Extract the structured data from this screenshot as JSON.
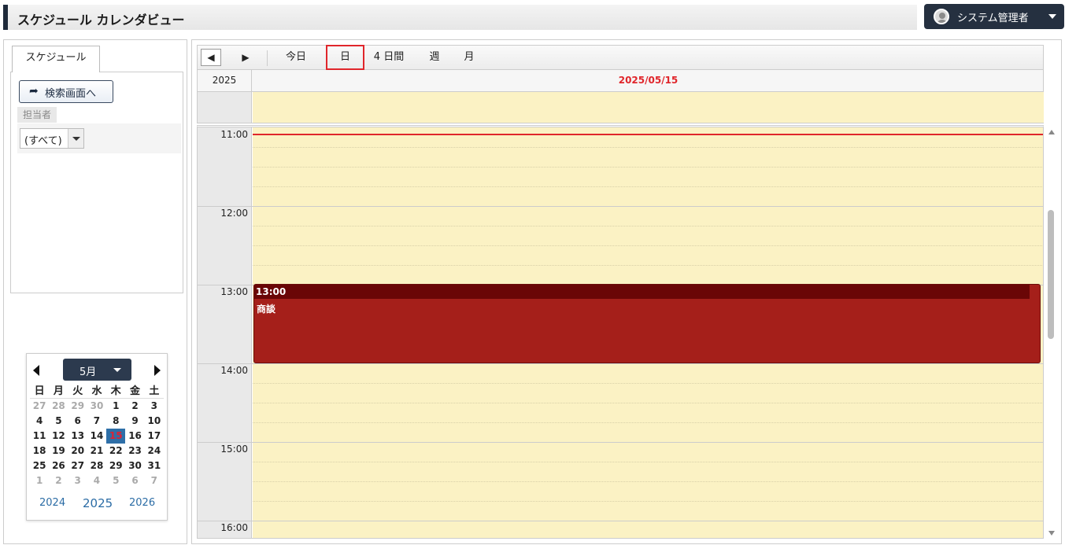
{
  "header": {
    "title": "スケジュール カレンダビュー",
    "user_name": "システム管理者"
  },
  "sidebar": {
    "tab_label": "スケジュール",
    "search_button": "検索画面へ",
    "assignee_label": "担当者",
    "assignee_value": "(すべて)"
  },
  "mini_calendar": {
    "month": "5月",
    "weekdays": [
      "日",
      "月",
      "火",
      "水",
      "木",
      "金",
      "土"
    ],
    "weeks": [
      [
        "27",
        "28",
        "29",
        "30",
        "1",
        "2",
        "3"
      ],
      [
        "4",
        "5",
        "6",
        "7",
        "8",
        "9",
        "10"
      ],
      [
        "11",
        "12",
        "13",
        "14",
        "15",
        "16",
        "17"
      ],
      [
        "18",
        "19",
        "20",
        "21",
        "22",
        "23",
        "24"
      ],
      [
        "25",
        "26",
        "27",
        "28",
        "29",
        "30",
        "31"
      ],
      [
        "1",
        "2",
        "3",
        "4",
        "5",
        "6",
        "7"
      ]
    ],
    "selected_day": "15",
    "years": [
      "2024",
      "2025",
      "2026"
    ]
  },
  "toolbar": {
    "prev": "◀",
    "next": "▶",
    "today": "今日",
    "day": "日",
    "four_days": "4 日間",
    "week": "週",
    "month": "月"
  },
  "calendar": {
    "year": "2025",
    "date": "2025/05/15",
    "hours": [
      "11:00",
      "12:00",
      "13:00",
      "14:00",
      "15:00",
      "16:00"
    ],
    "event": {
      "time": "13:00",
      "title": "商談"
    },
    "colors": {
      "event": "#a51f1a",
      "event_header": "#6a0606",
      "now_line": "#e0262b",
      "area": "#fbf2c4"
    }
  }
}
